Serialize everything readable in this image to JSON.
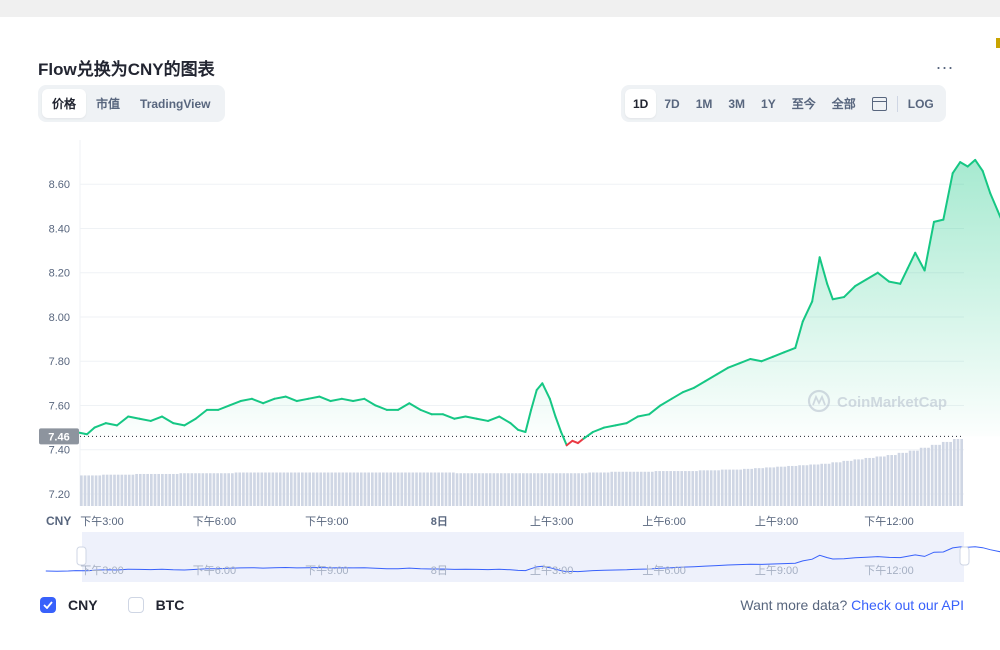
{
  "header": {
    "title": "Flow兑换为CNY的图表",
    "more_label": "..."
  },
  "view_tabs": [
    {
      "label": "价格",
      "active": true
    },
    {
      "label": "市值",
      "active": false
    },
    {
      "label": "TradingView",
      "active": false
    }
  ],
  "range_tabs": [
    {
      "label": "1D",
      "active": true
    },
    {
      "label": "7D",
      "active": false
    },
    {
      "label": "1M",
      "active": false
    },
    {
      "label": "3M",
      "active": false
    },
    {
      "label": "1Y",
      "active": false
    },
    {
      "label": "至今",
      "active": false
    },
    {
      "label": "全部",
      "active": false
    }
  ],
  "log_label": "LOG",
  "icons": {
    "calendar": "calendar-icon",
    "check": "check-icon",
    "logo": "coinmarketcap-logo-icon"
  },
  "colors": {
    "up": "#16c784",
    "down": "#ea3943",
    "accent": "#3861fb",
    "badge": "#8d949e"
  },
  "watermark": "CoinMarketCap",
  "axis_currency": "CNY",
  "chart_data": {
    "type": "line",
    "ylim": [
      7.15,
      8.8
    ],
    "y_ticks": [
      7.2,
      7.4,
      7.6,
      7.8,
      8.0,
      8.2,
      8.4,
      8.6
    ],
    "y_tick_labels": [
      "7.20",
      "7.40",
      "7.60",
      "7.80",
      "8.00",
      "8.20",
      "8.40",
      "8.60"
    ],
    "x_ticks": [
      {
        "label": "下午3:00",
        "t": 1.5
      },
      {
        "label": "下午6:00",
        "t": 4.5
      },
      {
        "label": "下午9:00",
        "t": 7.5
      },
      {
        "label": "8日",
        "t": 10.5
      },
      {
        "label": "上午3:00",
        "t": 13.5
      },
      {
        "label": "上午6:00",
        "t": 16.5
      },
      {
        "label": "上午9:00",
        "t": 19.5
      },
      {
        "label": "下午12:00",
        "t": 22.5
      }
    ],
    "x_range": [
      0,
      24
    ],
    "reference_price": 7.46,
    "reference_label": "7.46",
    "price": [
      [
        0.0,
        7.46
      ],
      [
        0.3,
        7.45
      ],
      [
        0.6,
        7.46
      ],
      [
        0.8,
        7.48
      ],
      [
        1.1,
        7.47
      ],
      [
        1.3,
        7.5
      ],
      [
        1.6,
        7.52
      ],
      [
        1.9,
        7.51
      ],
      [
        2.2,
        7.55
      ],
      [
        2.5,
        7.54
      ],
      [
        2.8,
        7.53
      ],
      [
        3.1,
        7.55
      ],
      [
        3.4,
        7.52
      ],
      [
        3.7,
        7.51
      ],
      [
        4.0,
        7.54
      ],
      [
        4.3,
        7.58
      ],
      [
        4.6,
        7.58
      ],
      [
        4.9,
        7.6
      ],
      [
        5.2,
        7.62
      ],
      [
        5.5,
        7.63
      ],
      [
        5.8,
        7.61
      ],
      [
        6.1,
        7.63
      ],
      [
        6.4,
        7.64
      ],
      [
        6.7,
        7.62
      ],
      [
        7.0,
        7.63
      ],
      [
        7.3,
        7.64
      ],
      [
        7.6,
        7.62
      ],
      [
        7.9,
        7.63
      ],
      [
        8.2,
        7.62
      ],
      [
        8.5,
        7.63
      ],
      [
        8.8,
        7.6
      ],
      [
        9.1,
        7.58
      ],
      [
        9.4,
        7.58
      ],
      [
        9.7,
        7.61
      ],
      [
        10.0,
        7.58
      ],
      [
        10.3,
        7.56
      ],
      [
        10.6,
        7.56
      ],
      [
        10.9,
        7.54
      ],
      [
        11.2,
        7.55
      ],
      [
        11.5,
        7.54
      ],
      [
        11.8,
        7.53
      ],
      [
        12.1,
        7.55
      ],
      [
        12.4,
        7.52
      ],
      [
        12.6,
        7.49
      ],
      [
        12.8,
        7.48
      ],
      [
        12.95,
        7.58
      ],
      [
        13.1,
        7.67
      ],
      [
        13.25,
        7.7
      ],
      [
        13.45,
        7.63
      ],
      [
        13.6,
        7.55
      ],
      [
        13.75,
        7.48
      ],
      [
        13.9,
        7.42
      ],
      [
        14.05,
        7.44
      ],
      [
        14.2,
        7.43
      ],
      [
        14.35,
        7.45
      ],
      [
        14.6,
        7.48
      ],
      [
        14.9,
        7.5
      ],
      [
        15.2,
        7.51
      ],
      [
        15.5,
        7.52
      ],
      [
        15.8,
        7.55
      ],
      [
        16.1,
        7.56
      ],
      [
        16.4,
        7.6
      ],
      [
        16.7,
        7.63
      ],
      [
        17.0,
        7.66
      ],
      [
        17.3,
        7.68
      ],
      [
        17.6,
        7.71
      ],
      [
        17.9,
        7.74
      ],
      [
        18.2,
        7.77
      ],
      [
        18.5,
        7.79
      ],
      [
        18.8,
        7.81
      ],
      [
        19.1,
        7.8
      ],
      [
        19.4,
        7.82
      ],
      [
        19.7,
        7.84
      ],
      [
        20.0,
        7.86
      ],
      [
        20.2,
        7.98
      ],
      [
        20.45,
        8.07
      ],
      [
        20.65,
        8.27
      ],
      [
        20.85,
        8.15
      ],
      [
        21.0,
        8.08
      ],
      [
        21.3,
        8.09
      ],
      [
        21.6,
        8.14
      ],
      [
        21.9,
        8.17
      ],
      [
        22.2,
        8.2
      ],
      [
        22.5,
        8.16
      ],
      [
        22.8,
        8.15
      ],
      [
        23.0,
        8.22
      ],
      [
        23.2,
        8.29
      ],
      [
        23.45,
        8.21
      ],
      [
        23.7,
        8.43
      ],
      [
        23.95,
        8.44
      ],
      [
        24.2,
        8.65
      ],
      [
        24.4,
        8.7
      ],
      [
        24.6,
        8.68
      ],
      [
        24.8,
        8.71
      ],
      [
        25.0,
        8.66
      ],
      [
        25.2,
        8.56
      ],
      [
        25.4,
        8.48
      ],
      [
        25.6,
        8.4
      ],
      [
        25.8,
        8.43
      ],
      [
        25.95,
        8.42
      ]
    ],
    "volume_level": [
      0.42,
      0.42,
      0.43,
      0.43,
      0.43,
      0.44,
      0.44,
      0.44,
      0.44,
      0.45,
      0.45,
      0.45,
      0.45,
      0.45,
      0.46,
      0.46,
      0.46,
      0.46,
      0.46,
      0.46,
      0.46,
      0.46,
      0.46,
      0.46,
      0.46,
      0.46,
      0.46,
      0.46,
      0.46,
      0.46,
      0.46,
      0.46,
      0.46,
      0.46,
      0.45,
      0.45,
      0.45,
      0.45,
      0.45,
      0.45,
      0.45,
      0.45,
      0.45,
      0.45,
      0.45,
      0.45,
      0.46,
      0.46,
      0.47,
      0.47,
      0.47,
      0.47,
      0.48,
      0.48,
      0.48,
      0.48,
      0.49,
      0.49,
      0.5,
      0.5,
      0.51,
      0.52,
      0.53,
      0.54,
      0.55,
      0.56,
      0.57,
      0.58,
      0.6,
      0.62,
      0.64,
      0.66,
      0.68,
      0.7,
      0.73,
      0.76,
      0.8,
      0.84,
      0.88,
      0.92
    ]
  },
  "legend": {
    "items": [
      {
        "label": "CNY",
        "checked": true
      },
      {
        "label": "BTC",
        "checked": false
      }
    ]
  },
  "footer": {
    "prompt": "Want more data?",
    "link": "Check out our API"
  }
}
